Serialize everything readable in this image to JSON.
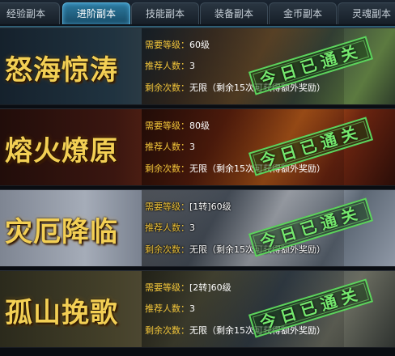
{
  "tabs": [
    {
      "label": "经验副本",
      "active": false
    },
    {
      "label": "进阶副本",
      "active": true
    },
    {
      "label": "技能副本",
      "active": false
    },
    {
      "label": "装备副本",
      "active": false
    },
    {
      "label": "金币副本",
      "active": false
    },
    {
      "label": "灵魂副本",
      "active": false
    }
  ],
  "labels": {
    "level": "需要等级：",
    "players": "推荐人数：",
    "remaining": "剩余次数："
  },
  "dungeons": [
    {
      "name": "怒海惊涛",
      "level": "60级",
      "players": "3",
      "remaining": "无限（剩余15次可获得额外奖励）",
      "stamp": "今日已通关"
    },
    {
      "name": "熔火燎原",
      "level": "80级",
      "players": "3",
      "remaining": "无限（剩余15次可获得额外奖励）",
      "stamp": "今日已通关"
    },
    {
      "name": "灾厄降临",
      "level": "[1转]60级",
      "players": "3",
      "remaining": "无限（剩余15次可获得额外奖励）",
      "stamp": "今日已通关"
    },
    {
      "name": "孤山挽歌",
      "level": "[2转]60级",
      "players": "3",
      "remaining": "无限（剩余15次可获得额外奖励）",
      "stamp": "今日已通关"
    }
  ],
  "colors": {
    "title_gold": "#f3cf54",
    "label_yellow": "#f3c63a",
    "stamp_green": "#75e86e",
    "active_tab": "#2c7aa0"
  }
}
